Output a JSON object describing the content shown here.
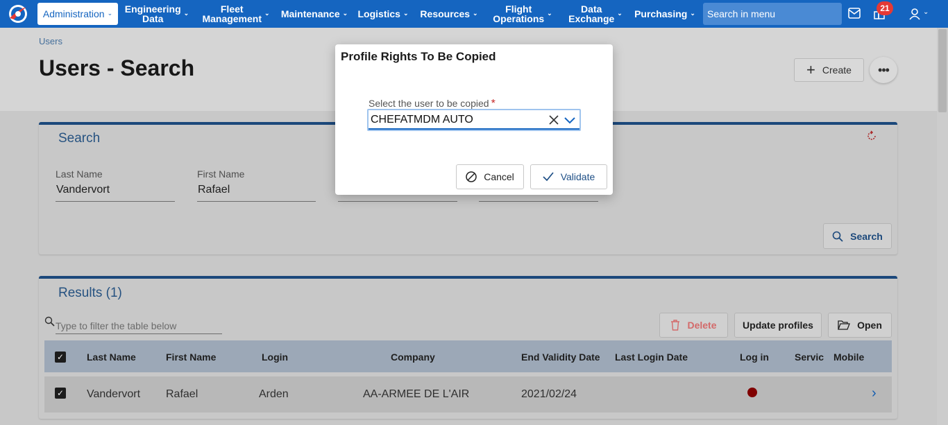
{
  "navbar": {
    "items": [
      {
        "label": "Administration"
      },
      {
        "line1": "Engineering",
        "line2": "Data"
      },
      {
        "line1": "Fleet",
        "line2": "Management"
      },
      {
        "label": "Maintenance"
      },
      {
        "label": "Logistics"
      },
      {
        "label": "Resources"
      },
      {
        "line1": "Flight",
        "line2": "Operations"
      },
      {
        "line1": "Data",
        "line2": "Exchange"
      },
      {
        "label": "Purchasing"
      }
    ],
    "search_placeholder": "Search in menu",
    "notification_count": "21"
  },
  "breadcrumb": "Users",
  "page_title": "Users - Search",
  "create_label": "Create",
  "search_panel": {
    "title": "Search",
    "fields": [
      {
        "label": "Last Name",
        "value": "Vandervort"
      },
      {
        "label": "First Name",
        "value": "Rafael"
      }
    ],
    "search_button": "Search"
  },
  "results_panel": {
    "title": "Results (1)",
    "filter_placeholder": "Type to filter the table below",
    "delete_button": "Delete",
    "update_button": "Update profiles",
    "open_button": "Open",
    "columns": [
      "Last Name",
      "First Name",
      "Login",
      "Company",
      "End Validity Date",
      "Last Login Date",
      "Log in",
      "Servic",
      "Mobile"
    ],
    "rows": [
      {
        "last_name": "Vandervort",
        "first_name": "Rafael",
        "login": "Arden",
        "company": "AA-ARMEE DE L'AIR",
        "end_validity": "2021/02/24",
        "last_login": ""
      }
    ]
  },
  "dialog": {
    "title": "Profile Rights To Be Copied",
    "field_label": "Select the user to be copied",
    "required_mark": "*",
    "selected_value": "CHEFATMDM AUTO",
    "cancel_label": "Cancel",
    "validate_label": "Validate"
  },
  "colors": {
    "brand": "#1565c0",
    "panel_accent": "#1e4f86",
    "status_red": "#8b0000",
    "delete_red": "#e57373"
  }
}
